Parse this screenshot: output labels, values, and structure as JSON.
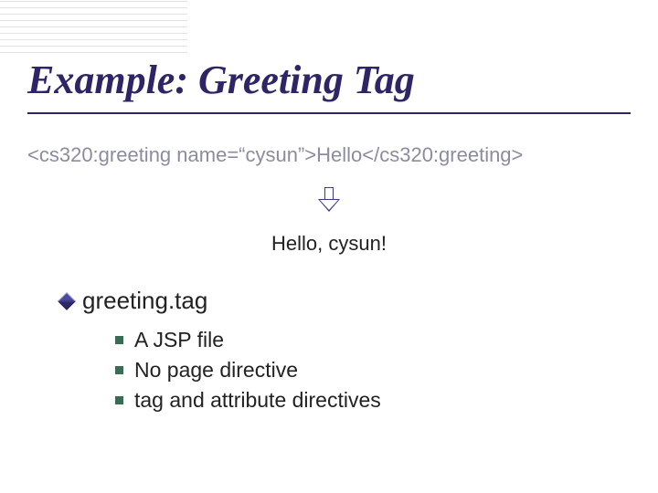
{
  "title": "Example: Greeting Tag",
  "code_line": "<cs320:greeting name=“cysun”>Hello</cs320:greeting>",
  "output_line": "Hello, cysun!",
  "main_bullet": "greeting.tag",
  "sub_bullets": [
    "A JSP file",
    "No page directive",
    "tag and attribute directives"
  ]
}
